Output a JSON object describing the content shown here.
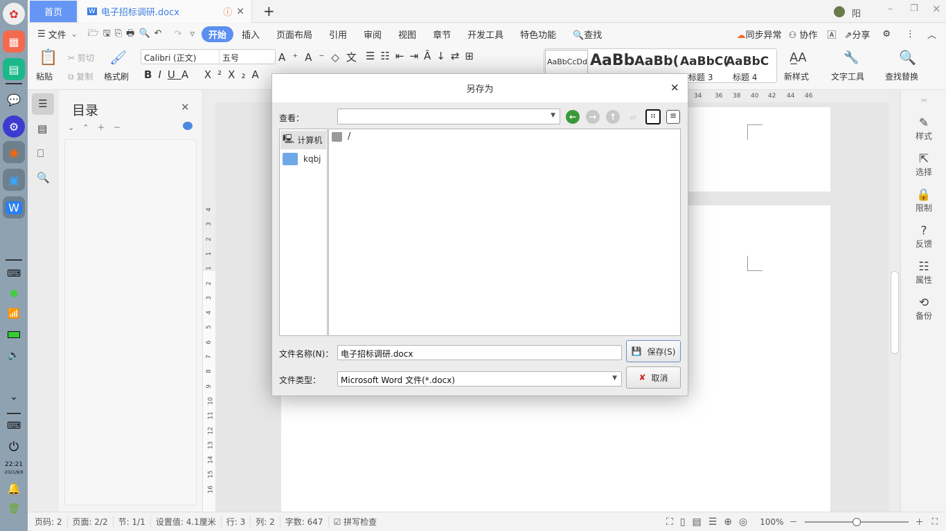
{
  "taskbar": {
    "clock_time": "22:21",
    "clock_date": "2021/8/9"
  },
  "tabs": {
    "home": "首页",
    "doc": "电子招标调研.docx",
    "new_tab": "+"
  },
  "user": {
    "name": "阳"
  },
  "menu": {
    "file": "文件",
    "items": [
      "开始",
      "插入",
      "页面布局",
      "引用",
      "审阅",
      "视图",
      "章节",
      "开发工具",
      "特色功能"
    ],
    "find": "查找",
    "sync": "同步异常",
    "collab": "协作",
    "share": "分享"
  },
  "ribbon": {
    "paste": "粘贴",
    "cut": "剪切",
    "copy": "复制",
    "format_painter": "格式刷",
    "font_name": "Calibri (正文)",
    "font_size": "五号",
    "styles": [
      "AaBbCcDd",
      "AaBb",
      "AaBb(",
      "AaBbC(",
      "AaBbC"
    ],
    "style_labels": [
      "标题 3",
      "标题 4"
    ],
    "new_style": "新样式",
    "text_tools": "文字工具",
    "find_replace": "查找替换"
  },
  "toc": {
    "title": "目录"
  },
  "ruler": {
    "top": [
      "34",
      "36",
      "38",
      "40",
      "42",
      "44",
      "46"
    ],
    "left": [
      "4",
      "3",
      "2",
      "1",
      "1",
      "2",
      "3",
      "4",
      "5",
      "6",
      "7",
      "8",
      "9",
      "10",
      "11",
      "12",
      "13",
      "14",
      "15",
      "16"
    ]
  },
  "right_panel": [
    "样式",
    "选择",
    "限制",
    "反馈",
    "属性",
    "备份"
  ],
  "status": {
    "page": "页码: 2",
    "pages": "页面: 2/2",
    "section": "节: 1/1",
    "setting": "设置值: 4.1厘米",
    "row": "行: 3",
    "col": "列: 2",
    "words": "字数: 647",
    "spell": "拼写检查",
    "zoom": "100%",
    "zoom_fraction": 0.5
  },
  "dialog": {
    "title": "另存为",
    "look_in_label": "查看：",
    "look_in_value": "",
    "sidebar": [
      "计算机",
      "kqbj"
    ],
    "files": [
      "/"
    ],
    "filename_label": "文件名称(N)：",
    "filename": "电子招标调研.docx",
    "filetype_label": "文件类型：",
    "filetype": "Microsoft Word 文件(*.docx)",
    "save": "保存(S)",
    "cancel": "取消"
  }
}
